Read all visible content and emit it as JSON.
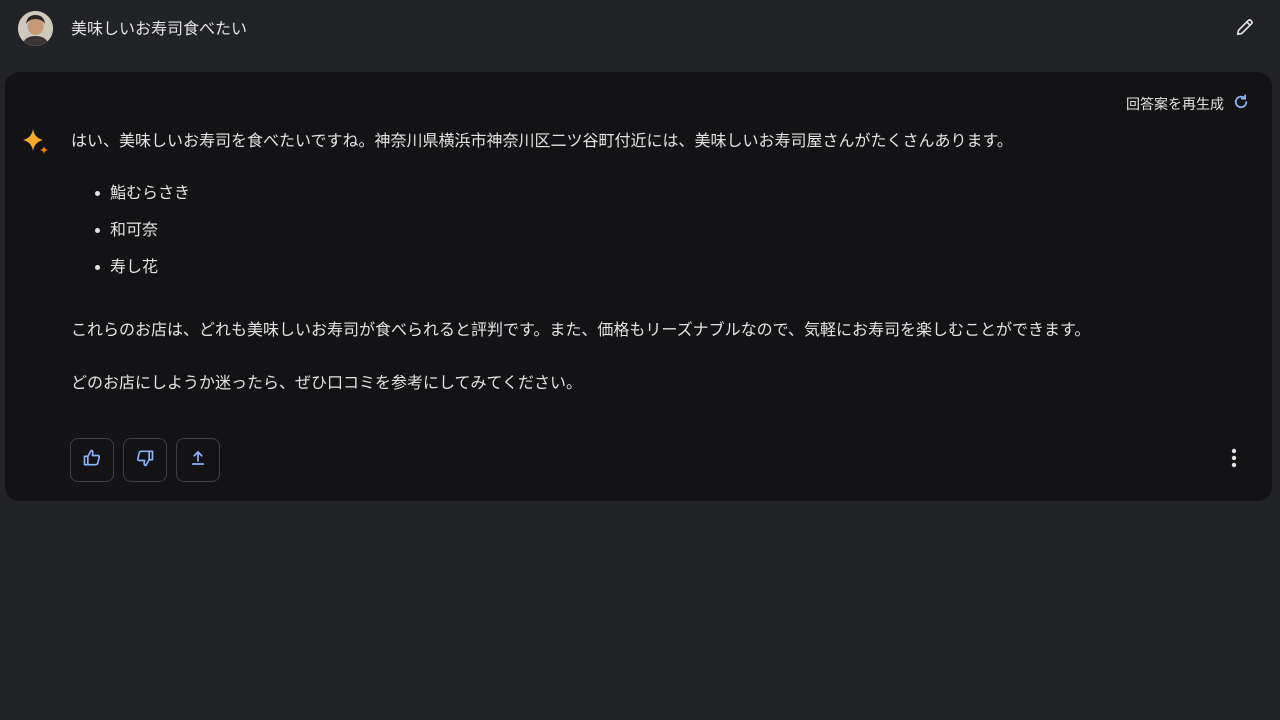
{
  "user": {
    "prompt": "美味しいお寿司食べたい",
    "avatar_icon": "user-avatar"
  },
  "toolbar": {
    "edit_icon": "pencil-icon"
  },
  "response": {
    "regenerate_label": "回答案を再生成",
    "regenerate_icon": "refresh-icon",
    "assistant_icon": "sparkle-icon",
    "intro": "はい、美味しいお寿司を食べたいですね。神奈川県横浜市神奈川区二ツ谷町付近には、美味しいお寿司屋さんがたくさんあります。",
    "items": [
      "鮨むらさき",
      "和可奈",
      "寿し花"
    ],
    "paragraph2": "これらのお店は、どれも美味しいお寿司が食べられると評判です。また、価格もリーズナブルなので、気軽にお寿司を楽しむことができます。",
    "paragraph3": "どのお店にしようか迷ったら、ぜひ口コミを参考にしてみてください。"
  },
  "actions": {
    "like_icon": "thumbs-up-icon",
    "dislike_icon": "thumbs-down-icon",
    "share_icon": "share-icon",
    "more_icon": "more-vertical-icon"
  },
  "colors": {
    "background": "#222326",
    "card": "#131316",
    "accent": "#8ab4f8",
    "sparkle": "#f9a825"
  }
}
